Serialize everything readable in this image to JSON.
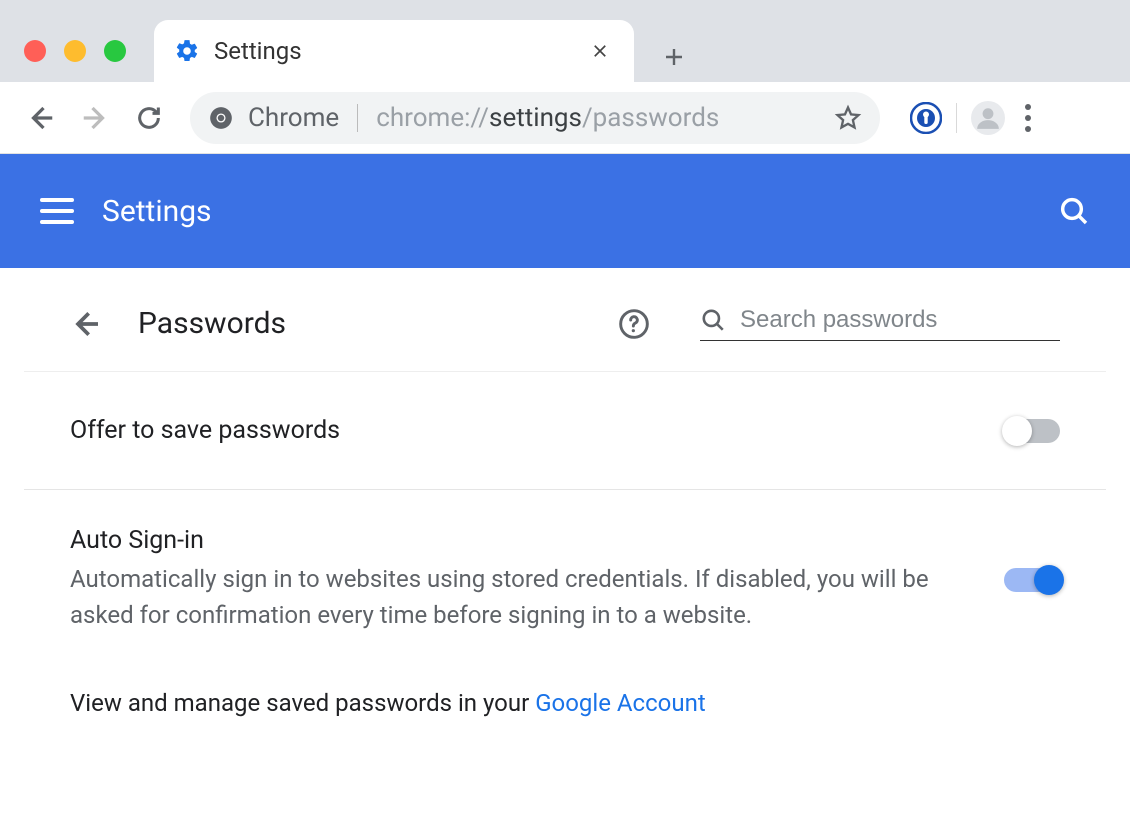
{
  "window": {
    "tab_title": "Settings"
  },
  "toolbar": {
    "scheme_label": "Chrome",
    "url_prefix": "chrome://",
    "url_bold": "settings",
    "url_suffix": "/passwords"
  },
  "app": {
    "title": "Settings"
  },
  "page": {
    "title": "Passwords",
    "search_placeholder": "Search passwords"
  },
  "settings": {
    "offer_save": {
      "label": "Offer to save passwords",
      "enabled": false
    },
    "auto_signin": {
      "label": "Auto Sign-in",
      "description": "Automatically sign in to websites using stored credentials. If disabled, you will be asked for confirmation every time before signing in to a website.",
      "enabled": true
    },
    "account_line": {
      "prefix": "View and manage saved passwords in your ",
      "link": "Google Account"
    }
  }
}
